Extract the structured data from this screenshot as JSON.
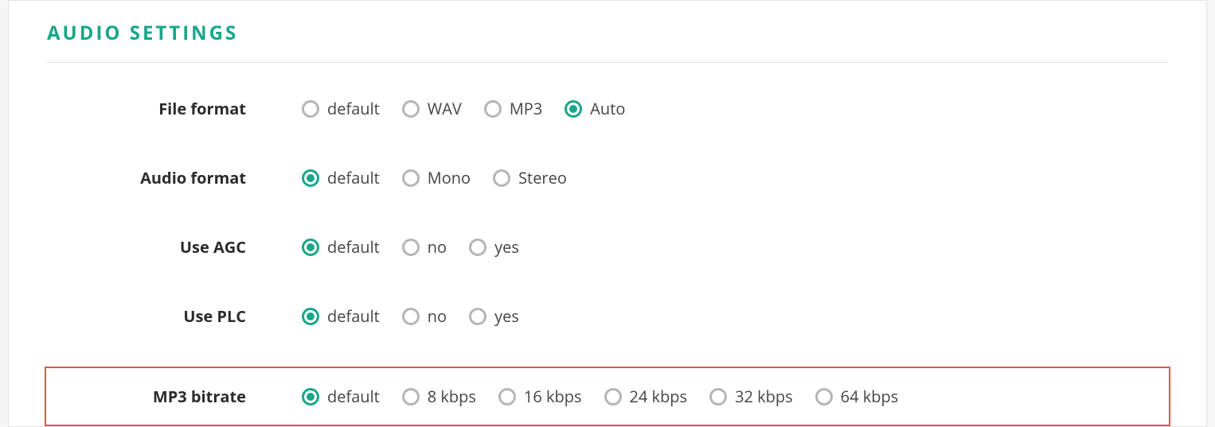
{
  "section_title": "AUDIO SETTINGS",
  "rows": {
    "file_format": {
      "label": "File format",
      "options": [
        {
          "label": "default",
          "selected": false
        },
        {
          "label": "WAV",
          "selected": false
        },
        {
          "label": "MP3",
          "selected": false
        },
        {
          "label": "Auto",
          "selected": true
        }
      ]
    },
    "audio_format": {
      "label": "Audio format",
      "options": [
        {
          "label": "default",
          "selected": true
        },
        {
          "label": "Mono",
          "selected": false
        },
        {
          "label": "Stereo",
          "selected": false
        }
      ]
    },
    "use_agc": {
      "label": "Use AGC",
      "options": [
        {
          "label": "default",
          "selected": true
        },
        {
          "label": "no",
          "selected": false
        },
        {
          "label": "yes",
          "selected": false
        }
      ]
    },
    "use_plc": {
      "label": "Use PLC",
      "options": [
        {
          "label": "default",
          "selected": true
        },
        {
          "label": "no",
          "selected": false
        },
        {
          "label": "yes",
          "selected": false
        }
      ]
    },
    "mp3_bitrate": {
      "label": "MP3 bitrate",
      "options": [
        {
          "label": "default",
          "selected": true
        },
        {
          "label": "8 kbps",
          "selected": false
        },
        {
          "label": "16 kbps",
          "selected": false
        },
        {
          "label": "24 kbps",
          "selected": false
        },
        {
          "label": "32 kbps",
          "selected": false
        },
        {
          "label": "64 kbps",
          "selected": false
        }
      ]
    }
  }
}
